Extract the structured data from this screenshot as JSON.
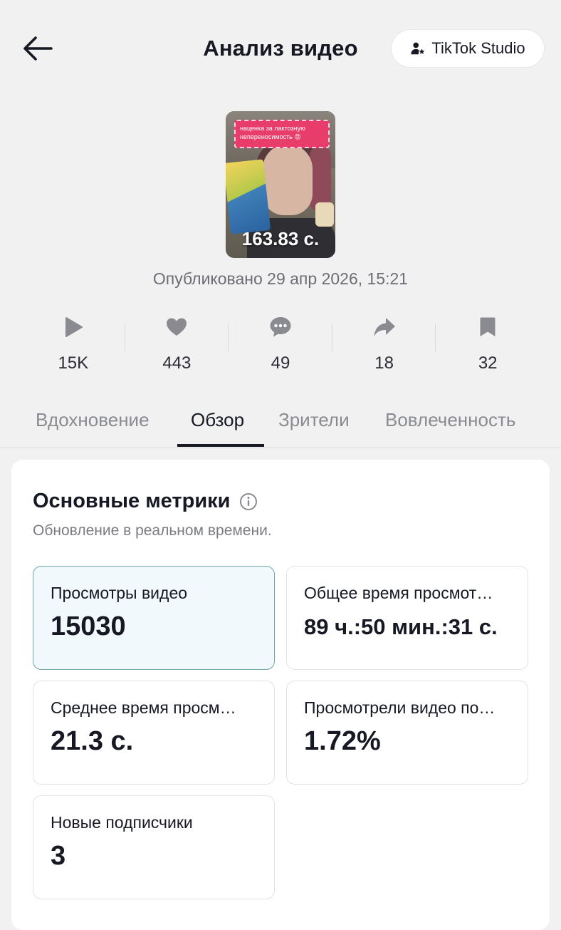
{
  "header": {
    "title": "Анализ видео",
    "studio_button": "TikTok Studio"
  },
  "video": {
    "thumbnail_caption": "наценка за лактозную непереносимость 😡",
    "duration": "163.83 с.",
    "published": "Опубликовано 29 апр 2026, 15:21"
  },
  "stats": [
    {
      "icon": "play-icon",
      "value": "15K"
    },
    {
      "icon": "heart-icon",
      "value": "443"
    },
    {
      "icon": "comment-icon",
      "value": "49"
    },
    {
      "icon": "share-icon",
      "value": "18"
    },
    {
      "icon": "bookmark-icon",
      "value": "32"
    }
  ],
  "tabs": [
    {
      "label": "Вдохновение",
      "active": false
    },
    {
      "label": "Обзор",
      "active": true
    },
    {
      "label": "Зрители",
      "active": false
    },
    {
      "label": "Вовлеченность",
      "active": false
    }
  ],
  "metrics_section": {
    "title": "Основные метрики",
    "subtitle": "Обновление в реальном времени.",
    "items": [
      {
        "label": "Просмотры видео",
        "value": "15030",
        "selected": true
      },
      {
        "label": "Общее время просмот…",
        "value": "89 ч.:50 мин.:31 с.",
        "selected": false
      },
      {
        "label": "Среднее время просм…",
        "value": "21.3 с.",
        "selected": false
      },
      {
        "label": "Просмотрели видео по…",
        "value": "1.72%",
        "selected": false
      },
      {
        "label": "Новые подписчики",
        "value": "3",
        "selected": false
      }
    ]
  },
  "colors": {
    "background": "#f1f1f2",
    "text_primary": "#161823",
    "text_secondary": "#8a8b91",
    "selected_card_bg": "#f2f9fd",
    "selected_card_border": "#6aa7a6"
  }
}
